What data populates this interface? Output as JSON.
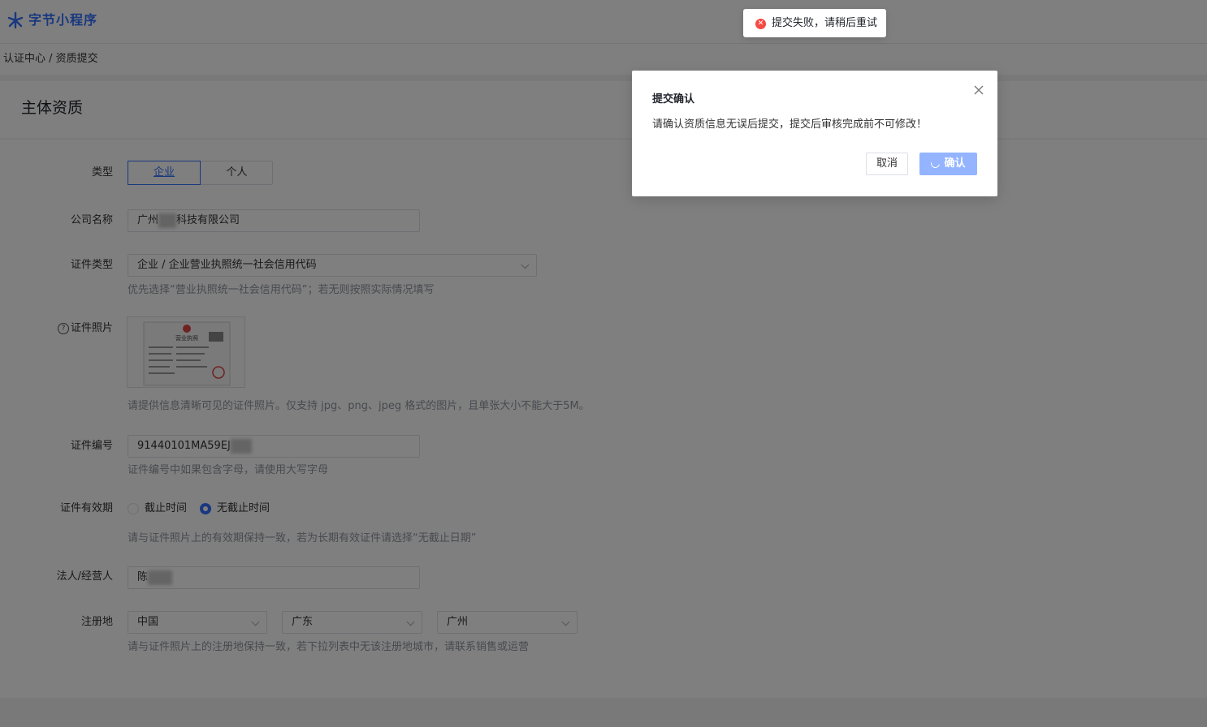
{
  "header": {
    "logo_text": "字节小程序"
  },
  "breadcrumb": "认证中心 / 资质提交",
  "page_title": "主体资质",
  "form": {
    "type": {
      "label": "类型",
      "options": [
        "企业",
        "个人"
      ],
      "selected": "企业"
    },
    "company_name": {
      "label": "公司名称",
      "value_prefix": "广州",
      "value_suffix": "科技有限公司"
    },
    "cert_type": {
      "label": "证件类型",
      "value": "企业 / 企业营业执照统一社会信用代码",
      "hint": "优先选择“营业执照统一社会信用代码”；若无则按照实际情况填写"
    },
    "cert_photo": {
      "label": "证件照片",
      "hint": "请提供信息清晰可见的证件照片。仅支持 jpg、png、jpeg 格式的图片，且单张大小不能大于5M。",
      "photo_title": "营业执照"
    },
    "cert_number": {
      "label": "证件编号",
      "value": "91440101MA59EJ",
      "hint": "证件编号中如果包含字母，请使用大写字母"
    },
    "cert_validity": {
      "label": "证件有效期",
      "options": [
        "截止时间",
        "无截止时间"
      ],
      "selected": "无截止时间",
      "hint": "请与证件照片上的有效期保持一致，若为长期有效证件请选择“无截止日期”"
    },
    "legal_person": {
      "label": "法人/经营人",
      "value": "陈"
    },
    "registration": {
      "label": "注册地",
      "country": "中国",
      "province": "广东",
      "city": "广州",
      "hint": "请与证件照片上的注册地保持一致，若下拉列表中无该注册地城市，请联系销售或运营"
    }
  },
  "modal": {
    "title": "提交确认",
    "message": "请确认资质信息无误后提交，提交后审核完成前不可修改！",
    "cancel_label": "取消",
    "confirm_label": "确认"
  },
  "toast": {
    "message": "提交失败，请稍后重试",
    "type": "error"
  },
  "colors": {
    "primary": "#3370ff",
    "error": "#f54a45",
    "confirm_loading": "#94b4ff"
  }
}
